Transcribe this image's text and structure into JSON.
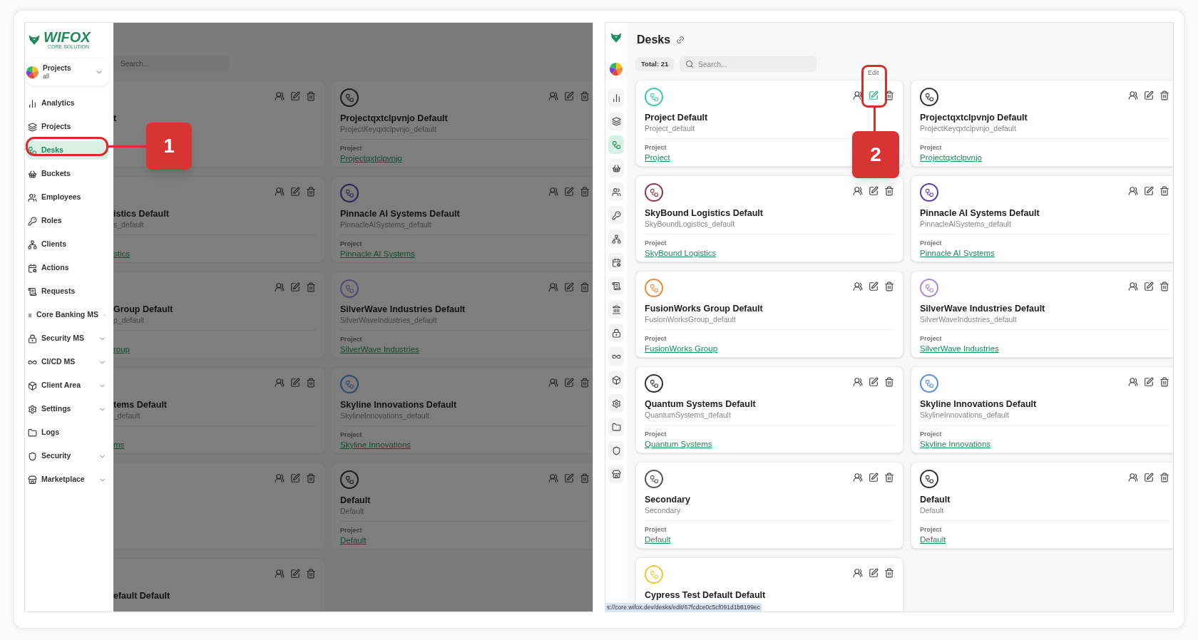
{
  "left_screen": {
    "logo": {
      "name": "WIFOX",
      "tagline": "CORE SOLUTION"
    },
    "project_selector": {
      "label": "Projects",
      "value": "all"
    },
    "sidebar": {
      "items": [
        {
          "label": "Analytics",
          "selected": false,
          "expandable": false
        },
        {
          "label": "Projects",
          "selected": false,
          "expandable": false
        },
        {
          "label": "Desks",
          "selected": true,
          "expandable": false
        },
        {
          "label": "Buckets",
          "selected": false,
          "expandable": false
        },
        {
          "label": "Employees",
          "selected": false,
          "expandable": false
        },
        {
          "label": "Roles",
          "selected": false,
          "expandable": false
        },
        {
          "label": "Clients",
          "selected": false,
          "expandable": false
        },
        {
          "label": "Actions",
          "selected": false,
          "expandable": false
        },
        {
          "label": "Requests",
          "selected": false,
          "expandable": false
        },
        {
          "label": "Core Banking MS",
          "selected": false,
          "expandable": true
        },
        {
          "label": "Security MS",
          "selected": false,
          "expandable": true
        },
        {
          "label": "CI/CD MS",
          "selected": false,
          "expandable": true
        },
        {
          "label": "Client Area",
          "selected": false,
          "expandable": true
        },
        {
          "label": "Settings",
          "selected": false,
          "expandable": true
        },
        {
          "label": "Logs",
          "selected": false,
          "expandable": false
        },
        {
          "label": "Security",
          "selected": false,
          "expandable": true
        },
        {
          "label": "Marketplace",
          "selected": false,
          "expandable": true
        }
      ]
    },
    "search": {
      "placeholder": "Search..."
    },
    "cards_column_1": [
      {
        "kind": "cut",
        "title": "t"
      },
      {
        "kind": "cut",
        "title": "istics Default",
        "subtitle": "s_default",
        "link": "stics"
      },
      {
        "kind": "cut",
        "title": "Group Default",
        "subtitle": "p_default",
        "link": "roup"
      },
      {
        "kind": "cut",
        "title": "tems Default",
        "subtitle": "_default",
        "link": "ms"
      },
      {
        "kind": "cut"
      },
      {
        "kind": "cut",
        "title": "efault Default"
      }
    ],
    "cards_column_2": [
      {
        "title": "Projectqxtclpvnjo Default",
        "subtitle": "ProjectKeyqxtclpvnjo_default",
        "label": "Project",
        "link": "Projectqxtclpvnjo",
        "color": "#1a1a1a"
      },
      {
        "title": "Pinnacle AI Systems Default",
        "subtitle": "PinnacleAISystems_default",
        "label": "Project",
        "link": "Pinnacle AI Systems",
        "color": "#2e2054"
      },
      {
        "title": "SilverWave Industries Default",
        "subtitle": "SilverWaveIndustries_default",
        "label": "Project",
        "link": "SilverWave Industries",
        "color": "#54466e"
      },
      {
        "title": "Skyline Innovations Default",
        "subtitle": "SkylineInnovations_default",
        "label": "Project",
        "link": "Skyline Innovations",
        "color": "#2e486b"
      },
      {
        "title": "Default",
        "subtitle": "Default",
        "label": "Project",
        "link": "Default",
        "color": "#1a1a1a"
      }
    ]
  },
  "callouts": [
    {
      "number": "1"
    },
    {
      "number": "2"
    }
  ],
  "right_screen": {
    "rail": [
      {
        "selected": false
      },
      {
        "selected": false
      },
      {
        "selected": true
      },
      {
        "selected": false
      },
      {
        "selected": false
      },
      {
        "selected": false
      },
      {
        "selected": false
      },
      {
        "selected": false
      },
      {
        "selected": false
      },
      {
        "selected": false
      },
      {
        "selected": false
      },
      {
        "selected": false
      },
      {
        "selected": false
      },
      {
        "selected": false
      },
      {
        "selected": false
      },
      {
        "selected": false
      },
      {
        "selected": false
      }
    ],
    "title": "Desks",
    "total": "Total: 21",
    "search": {
      "placeholder": "Search..."
    },
    "tooltip": "Edit",
    "cards_column_1": [
      {
        "title": "Project Default",
        "subtitle": "Project_default",
        "label": "Project",
        "link": "Project",
        "color": "#3cc9a6",
        "edit_hovered": true
      },
      {
        "title": "SkyBound Logistics Default",
        "subtitle": "SkyBoundLogistics_default",
        "label": "Project",
        "link": "SkyBound Logistics",
        "color": "#8b3a4a",
        "edit_hovered": false
      },
      {
        "title": "FusionWorks Group Default",
        "subtitle": "FusionWorksGroup_default",
        "label": "Project",
        "link": "FusionWorks Group",
        "color": "#f08a3c",
        "edit_hovered": false
      },
      {
        "title": "Quantum Systems Default",
        "subtitle": "QuantumSystems_default",
        "label": "Project",
        "link": "Quantum Systems",
        "color": "#333333",
        "edit_hovered": false
      },
      {
        "title": "Secondary",
        "subtitle": "Secondary",
        "label": "Project",
        "link": "Default",
        "color": "#555555",
        "edit_hovered": false
      },
      {
        "title": "Cypress Test Default Default",
        "color": "#e8c93a",
        "edit_hovered": false
      }
    ],
    "cards_column_2": [
      {
        "title": "Projectqxtclpvnjo Default",
        "subtitle": "ProjectKeyqxtclpvnjo_default",
        "label": "Project",
        "link": "Projectqxtclpvnjo",
        "color": "#333333",
        "edit_hovered": false
      },
      {
        "title": "Pinnacle AI Systems Default",
        "subtitle": "PinnacleAISystems_default",
        "label": "Project",
        "link": "Pinnacle AI Systems",
        "color": "#5b3fa8",
        "edit_hovered": false
      },
      {
        "title": "SilverWave Industries Default",
        "subtitle": "SilverWaveIndustries_default",
        "label": "Project",
        "link": "SilverWave Industries",
        "color": "#a78bdb",
        "edit_hovered": false
      },
      {
        "title": "Skyline Innovations Default",
        "subtitle": "SkylineInnovations_default",
        "label": "Project",
        "link": "Skyline Innovations",
        "color": "#5b8fd6",
        "edit_hovered": false
      },
      {
        "title": "Default",
        "subtitle": "Default",
        "label": "Project",
        "link": "Default",
        "color": "#333333",
        "edit_hovered": false
      }
    ],
    "status_url": "s://core.wifox.dev/desks/edit/67fcdce0c5cf091d1b8199ec"
  }
}
